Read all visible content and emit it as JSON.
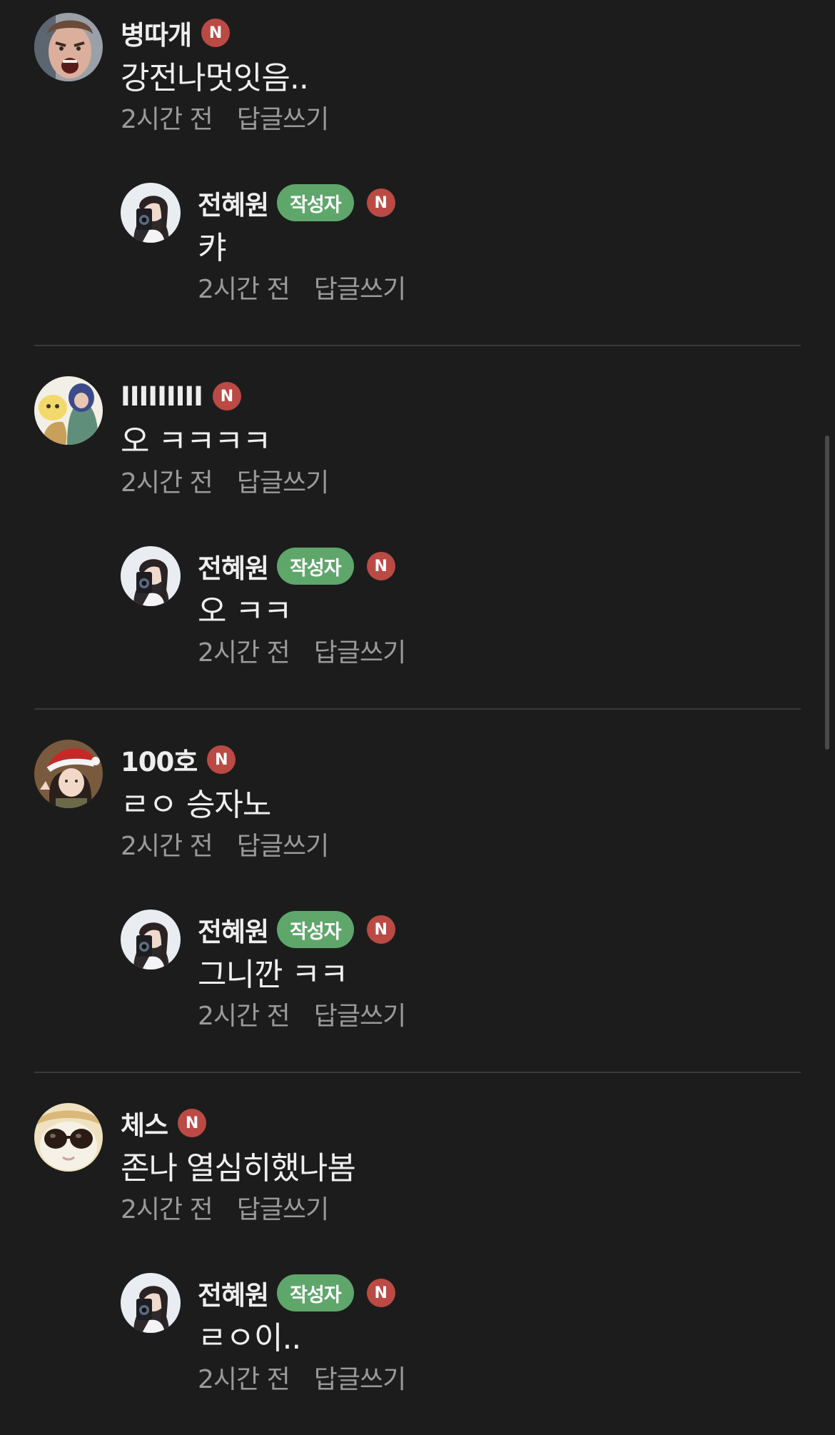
{
  "comments": [
    {
      "name": "병따개",
      "new_badge": "N",
      "text": "강전나멋잇음..",
      "time": "2시간 전",
      "reply_action": "답글쓰기",
      "avatar_icon": "angry-man-face",
      "reply": {
        "name": "전혜원",
        "author_badge": "작성자",
        "new_badge": "N",
        "text": "캬",
        "time": "2시간 전",
        "reply_action": "답글쓰기",
        "avatar_icon": "woman-with-camera"
      }
    },
    {
      "name": "IIIIIIIII",
      "new_badge": "N",
      "text": "오 ㅋㅋㅋㅋ",
      "time": "2시간 전",
      "reply_action": "답글쓰기",
      "avatar_icon": "cartoon-characters",
      "reply": {
        "name": "전혜원",
        "author_badge": "작성자",
        "new_badge": "N",
        "text": "오 ㅋㅋ",
        "time": "2시간 전",
        "reply_action": "답글쓰기",
        "avatar_icon": "woman-with-camera"
      }
    },
    {
      "name": "100호",
      "new_badge": "N",
      "text": "ㄹㅇ 승자노",
      "time": "2시간 전",
      "reply_action": "답글쓰기",
      "avatar_icon": "girl-santa-hat",
      "reply": {
        "name": "전혜원",
        "author_badge": "작성자",
        "new_badge": "N",
        "text": "그니깐 ㅋㅋ",
        "time": "2시간 전",
        "reply_action": "답글쓰기",
        "avatar_icon": "woman-with-camera"
      }
    },
    {
      "name": "체스",
      "new_badge": "N",
      "text": "존나 열심히했나봄",
      "time": "2시간 전",
      "reply_action": "답글쓰기",
      "avatar_icon": "cartoon-sunglasses",
      "reply": {
        "name": "전혜원",
        "author_badge": "작성자",
        "new_badge": "N",
        "text": "ㄹㅇ이..",
        "time": "2시간 전",
        "reply_action": "답글쓰기",
        "avatar_icon": "woman-with-camera"
      }
    }
  ],
  "colors": {
    "background": "#1c1c1d",
    "new_badge": "#bb4a44",
    "author_badge": "#5fa66b",
    "meta_text": "#9a9a9a",
    "divider": "#3a3a3c"
  }
}
